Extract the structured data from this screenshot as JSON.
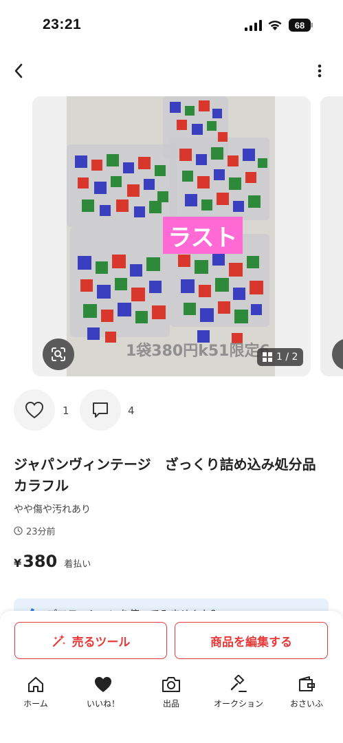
{
  "status_bar": {
    "time": "23:21",
    "battery": "68"
  },
  "nav": {
    "back_icon": "chevron-left-icon",
    "more_icon": "vertical-ellipsis-icon"
  },
  "photo": {
    "badge_text": "ラスト",
    "caption": "1袋380円k51限定6",
    "page_counter": "1 / 2",
    "badge_color": "#ff6ad5"
  },
  "actions": {
    "like_count": "1",
    "comment_count": "4"
  },
  "product": {
    "title": "ジャパンヴィンテージ　ざっくり詰め込み処分品　カラフル",
    "condition": "やや傷や汚れあり",
    "listed_ago": "23分前",
    "currency": "¥",
    "price": "380",
    "shipping": "着払い"
  },
  "promo": {
    "text": "プロモーションを使ってみませんか？"
  },
  "buttons": {
    "sell_tool": "売るツール",
    "edit_item": "商品を編集する",
    "accent_color": "#e8393a"
  },
  "tabs": [
    {
      "label": "ホーム",
      "icon": "home-icon"
    },
    {
      "label": "いいね！",
      "icon": "heart-icon"
    },
    {
      "label": "出品",
      "icon": "camera-icon"
    },
    {
      "label": "オークション",
      "icon": "gavel-icon"
    },
    {
      "label": "おさいふ",
      "icon": "wallet-icon"
    }
  ]
}
